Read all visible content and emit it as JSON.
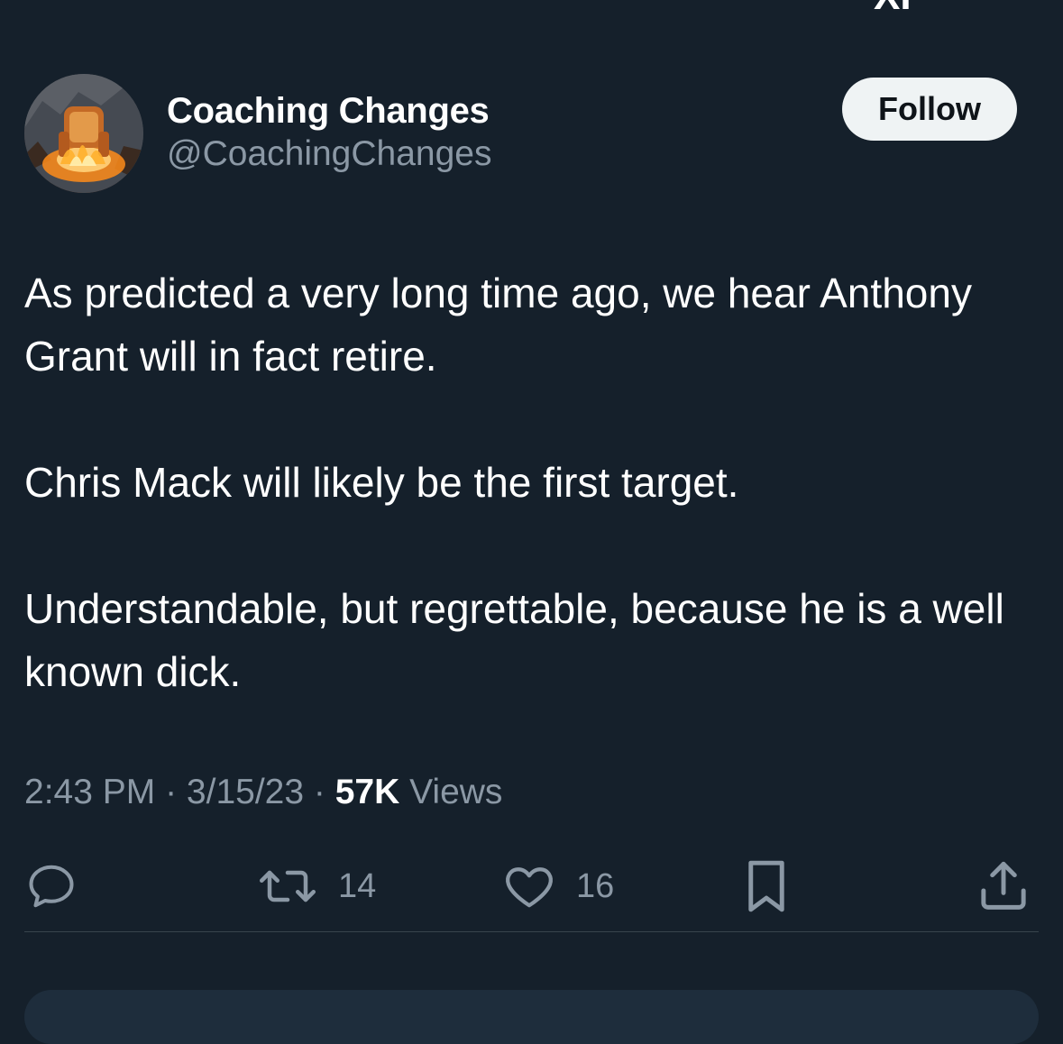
{
  "top_fragment": {
    "text": "XI"
  },
  "author": {
    "display_name": "Coaching Changes",
    "handle": "@CoachingChanges"
  },
  "follow_button": {
    "label": "Follow"
  },
  "tweet": {
    "paragraphs": [
      "As predicted a very long time ago, we hear Anthony Grant will in fact retire.",
      "Chris Mack will likely be the first target.",
      "Understandable, but regrettable, because he is a well known dick."
    ]
  },
  "meta": {
    "time": "2:43 PM",
    "separator": " · ",
    "date": "3/15/23",
    "views_count": "57K",
    "views_label": "Views"
  },
  "actions": {
    "reply_icon": "reply-icon",
    "retweet_icon": "retweet-icon",
    "retweet_count": "14",
    "like_icon": "heart-icon",
    "like_count": "16",
    "bookmark_icon": "bookmark-icon",
    "share_icon": "share-icon"
  },
  "colors": {
    "background": "#15202b",
    "text_primary": "#ffffff",
    "text_secondary": "#8b98a5",
    "divider": "#38444d",
    "follow_button_bg": "#eff3f4"
  }
}
